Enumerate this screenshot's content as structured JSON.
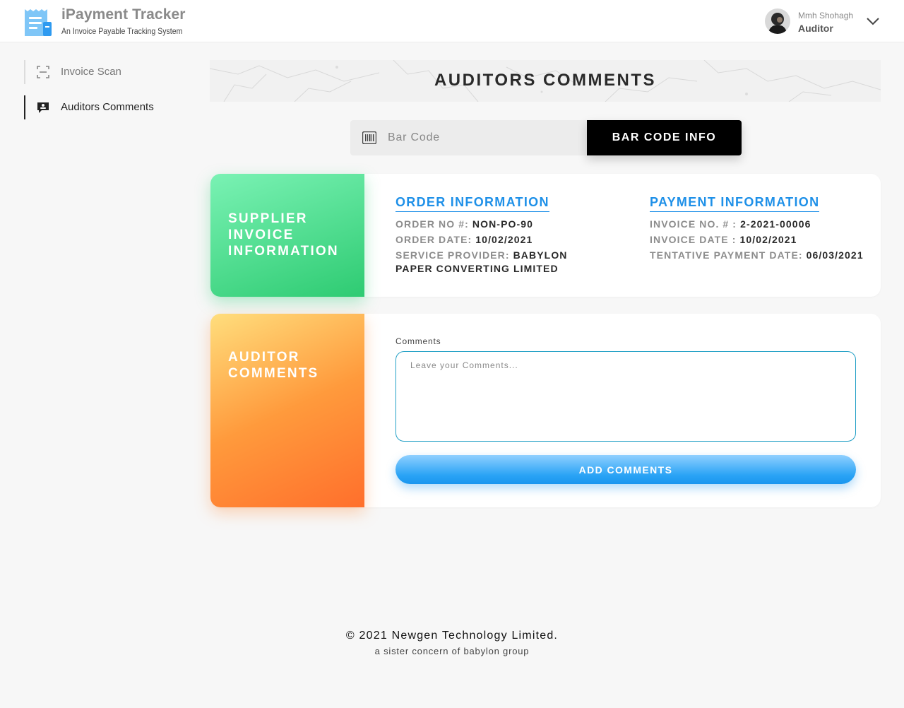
{
  "header": {
    "app_title": "iPayment Tracker",
    "app_subtitle": "An Invoice Payable Tracking System",
    "user_name": "Mmh Shohagh",
    "user_role": "Auditor",
    "brand_color": "#3aa0f0"
  },
  "sidebar": {
    "items": [
      {
        "label": "Invoice Scan",
        "icon": "scan-icon",
        "active": false
      },
      {
        "label": "Auditors Comments",
        "icon": "comment-icon",
        "active": true
      }
    ]
  },
  "main": {
    "page_title": "AUDITORS COMMENTS",
    "barcode": {
      "placeholder": "Bar Code",
      "value": "",
      "button_label": "BAR CODE INFO"
    },
    "supplier_card": {
      "tile_title": "SUPPLIER INVOICE INFORMATION",
      "order": {
        "heading": "ORDER INFORMATION",
        "order_no_label": "ORDER NO #:",
        "order_no": "NON-PO-90",
        "order_date_label": "ORDER DATE:",
        "order_date": "10/02/2021",
        "service_provider_label": "SERVICE PROVIDER:",
        "service_provider": "BABYLON PAPER CONVERTING LIMITED"
      },
      "payment": {
        "heading": "PAYMENT INFORMATION",
        "invoice_no_label": "INVOICE NO. # :",
        "invoice_no": "2-2021-00006",
        "invoice_date_label": "INVOICE DATE :",
        "invoice_date": "10/02/2021",
        "tentative_label": "TENTATIVE PAYMENT DATE:",
        "tentative_date": "06/03/2021"
      }
    },
    "auditor_card": {
      "tile_title": "AUDITOR COMMENTS",
      "comments_label": "Comments",
      "comments_placeholder": "Leave your Comments...",
      "comments_value": "",
      "add_button_label": "ADD COMMENTS"
    }
  },
  "footer": {
    "copyright": "© 2021 Newgen Technology Limited.",
    "tagline": "a sister concern of babylon group"
  },
  "colors": {
    "green_start": "#7af2b4",
    "green_end": "#2ecb72",
    "orange_start": "#ffde7d",
    "orange_end": "#ff6f2c",
    "accent_blue": "#1e90e8",
    "dark_button": "#000000"
  }
}
